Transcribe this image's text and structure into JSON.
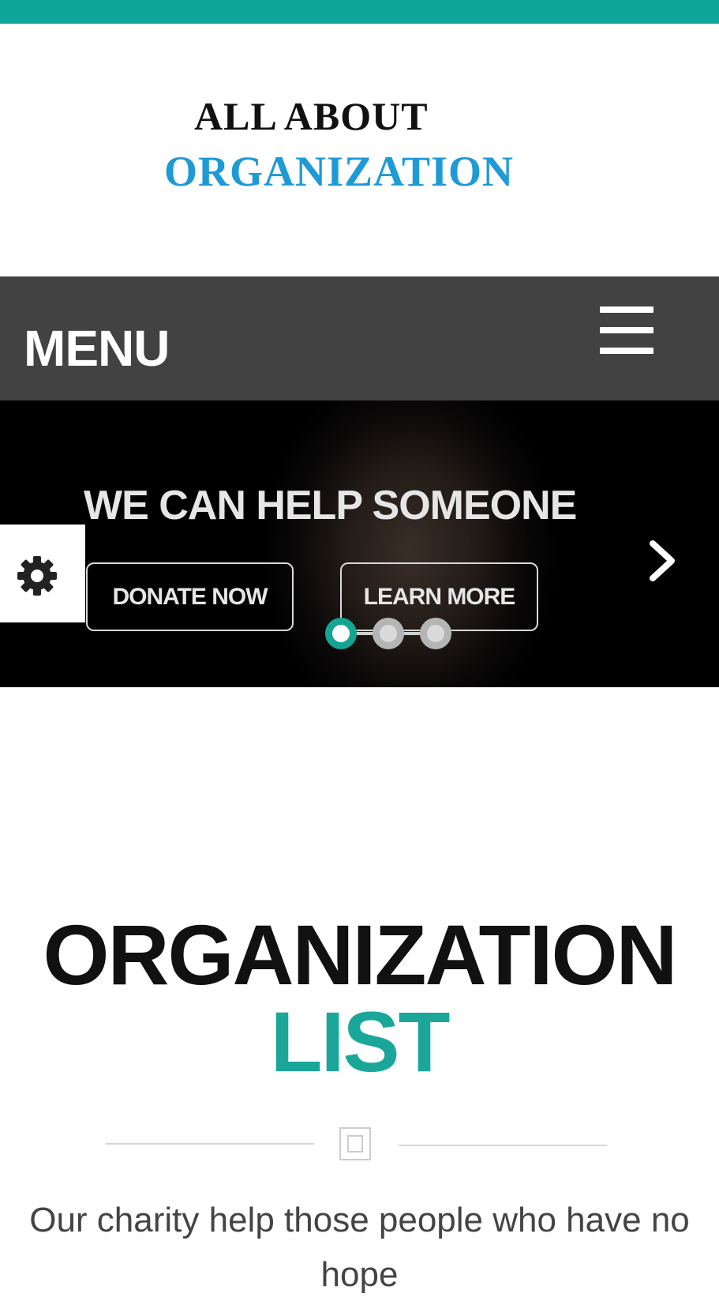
{
  "brand": {
    "line1": "ALL ABOUT",
    "line2": "ORGANIZATION",
    "accent_color": "#1e9ad6"
  },
  "header": {
    "strip_color": "#0fa69a"
  },
  "nav": {
    "menu_label": "MENU",
    "toggle_icon": "hamburger-icon"
  },
  "hero": {
    "title": "WE CAN HELP SOMEONE",
    "donate_label": "DONATE NOW",
    "learn_label": "LEARN MORE",
    "slides_total": 3,
    "active_slide": 1,
    "next_icon": "chevron-right-icon",
    "settings_icon": "gear-icon"
  },
  "section": {
    "title_part1": "ORGANIZATION",
    "title_part2": "LIST",
    "accent_color": "#1aa79a",
    "description": "Our charity help those people who have no hope"
  }
}
